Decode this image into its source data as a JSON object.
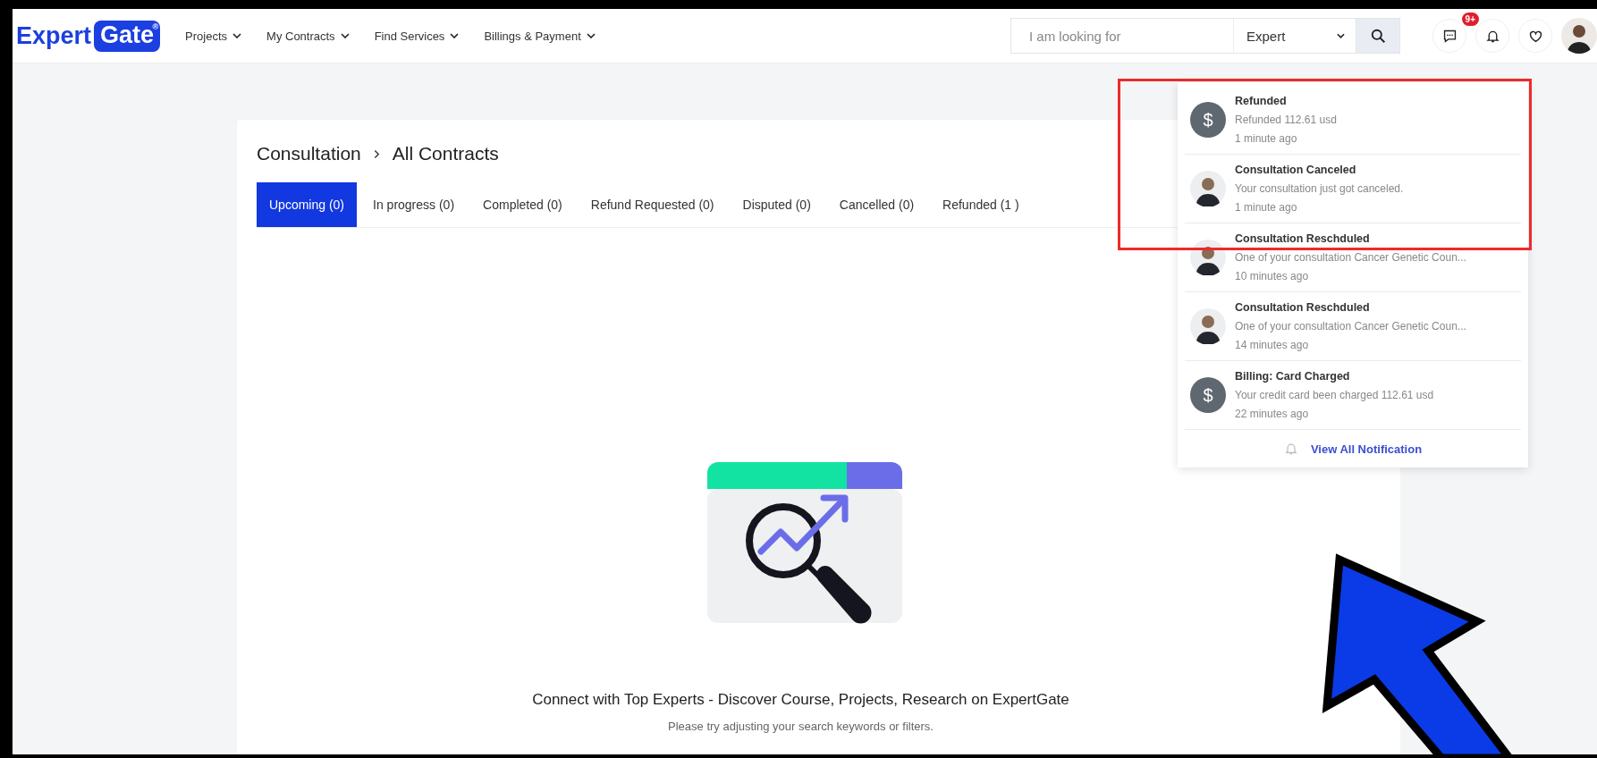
{
  "header": {
    "logo": {
      "word": "Expert",
      "boxed_word": "Gate",
      "registered": "®"
    },
    "nav": [
      {
        "label": "Projects"
      },
      {
        "label": "My Contracts"
      },
      {
        "label": "Find Services"
      },
      {
        "label": "Billings & Payment"
      }
    ],
    "search": {
      "placeholder": "I am looking for",
      "category": "Expert"
    },
    "notification_badge": "9+"
  },
  "breadcrumb": [
    "Consultation",
    "All Contracts"
  ],
  "tabs": [
    {
      "label": "Upcoming (0)",
      "selected": true
    },
    {
      "label": "In progress (0)",
      "selected": false
    },
    {
      "label": "Completed (0)",
      "selected": false
    },
    {
      "label": "Refund Requested (0)",
      "selected": false
    },
    {
      "label": "Disputed (0)",
      "selected": false
    },
    {
      "label": "Cancelled (0)",
      "selected": false
    },
    {
      "label": "Refunded (1 )",
      "selected": false
    }
  ],
  "empty_state": {
    "title": "Connect with Top Experts - Discover Course, Projects, Research on ExpertGate",
    "subtitle": "Please try adjusting your search keywords or filters."
  },
  "notifications": {
    "items": [
      {
        "kind": "payment",
        "symbol": "$",
        "title": "Refunded",
        "body": "Refunded 112.61 usd",
        "time": "1 minute ago"
      },
      {
        "kind": "person",
        "title": "Consultation Canceled",
        "body": "Your consultation just got canceled.",
        "time": "1 minute ago"
      },
      {
        "kind": "person",
        "title": "Consultation Reschduled",
        "body": "One of your consultation Cancer Genetic Coun...",
        "time": "10 minutes ago"
      },
      {
        "kind": "person",
        "title": "Consultation Reschduled",
        "body": "One of your consultation Cancer Genetic Coun...",
        "time": "14 minutes ago"
      },
      {
        "kind": "payment",
        "symbol": "$",
        "title": "Billing: Card Charged",
        "body": "Your credit card been charged 112.61 usd",
        "time": "22 minutes ago"
      }
    ],
    "footer": "View All Notification"
  }
}
